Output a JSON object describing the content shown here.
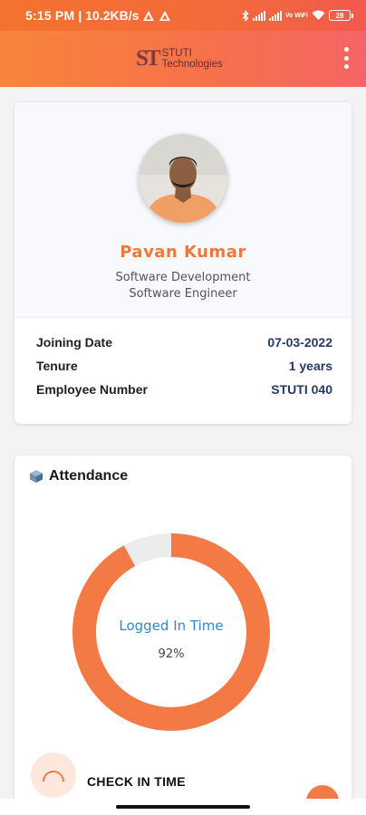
{
  "status_bar": {
    "time": "5:15 PM",
    "separator": "|",
    "network_speed": "10.2KB/s",
    "volte_label": "Vo WiFi",
    "battery": "28"
  },
  "app_bar": {
    "logo_mark": "ST",
    "logo_line1": "STUTI",
    "logo_line2": "Technologies",
    "menu_icon": "more-vert-icon"
  },
  "profile": {
    "name": "Pavan Kumar",
    "department": "Software Development",
    "designation": "Software Engineer",
    "details": [
      {
        "label": "Joining Date",
        "value": "07-03-2022"
      },
      {
        "label": "Tenure",
        "value": "1 years"
      },
      {
        "label": "Employee Number",
        "value": "STUTI 040"
      }
    ]
  },
  "attendance": {
    "title": "Attendance",
    "chart_label": "Logged In Time",
    "percent_text": "92%",
    "percent_value": 92,
    "checkin_label": "CHECK IN TIME"
  },
  "colors": {
    "accent": "#f47735",
    "link_blue": "#2a8bd1",
    "value_navy": "#263a6a"
  }
}
